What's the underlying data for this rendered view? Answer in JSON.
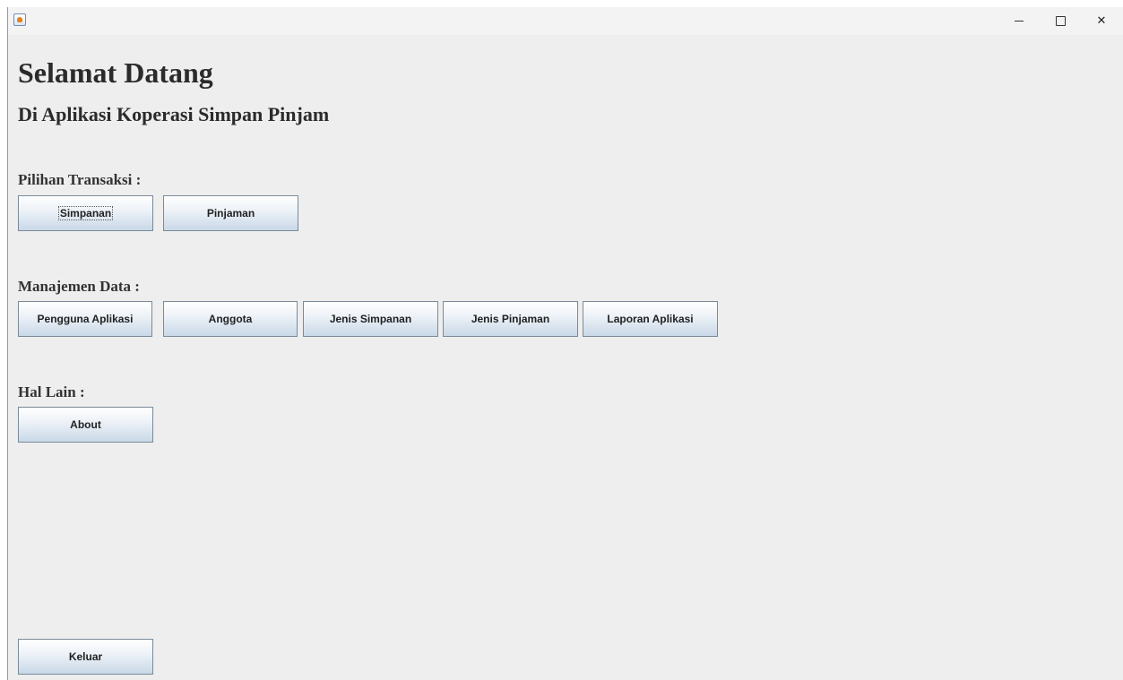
{
  "window": {
    "title": "",
    "controls": {
      "minimize": "—",
      "maximize": "☐",
      "close": "✕"
    }
  },
  "header": {
    "title": "Selamat Datang",
    "subtitle": "Di Aplikasi Koperasi Simpan Pinjam"
  },
  "transaksi": {
    "label": "Pilihan Transaksi :",
    "buttons": [
      "Simpanan",
      "Pinjaman"
    ]
  },
  "manajemen": {
    "label": "Manajemen Data :",
    "buttons": [
      "Pengguna Aplikasi",
      "Anggota",
      "Jenis Simpanan",
      "Jenis Pinjaman",
      "Laporan Aplikasi"
    ]
  },
  "lain": {
    "label": "Hal Lain :",
    "buttons": [
      "About"
    ]
  },
  "footer": {
    "exit_label": "Keluar"
  },
  "colors": {
    "background": "#eeeeee",
    "button_gradient_top": "#ffffff",
    "button_gradient_bottom": "#c9d8e8"
  }
}
